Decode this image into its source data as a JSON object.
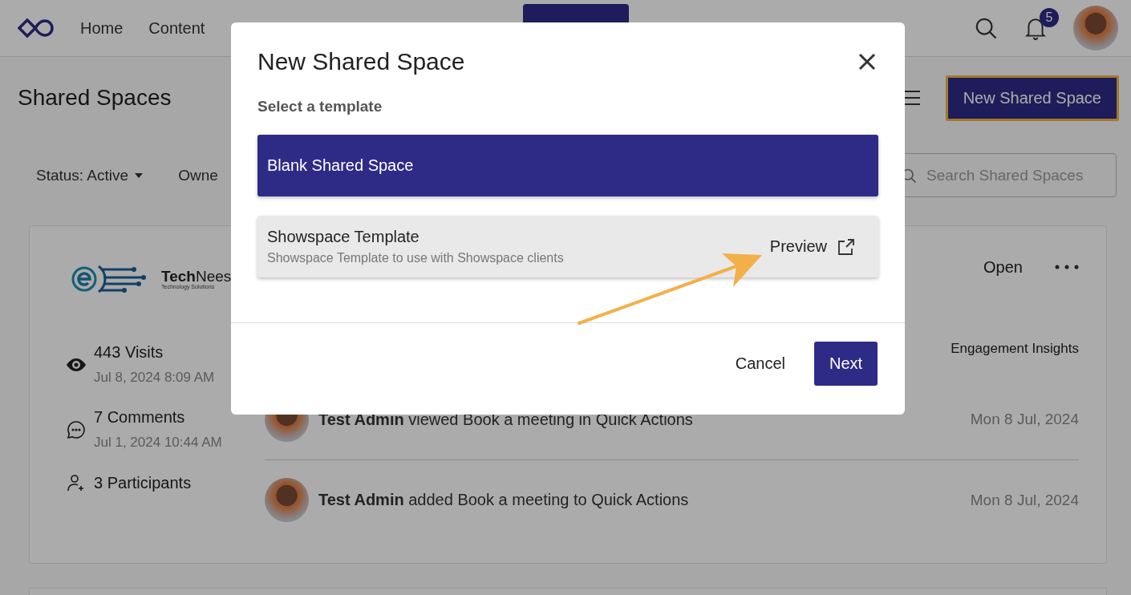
{
  "nav": {
    "items": [
      {
        "label": "Home"
      },
      {
        "label": "Content"
      }
    ],
    "notifications": "5"
  },
  "page": {
    "title": "Shared Spaces",
    "new_button": "New Shared Space"
  },
  "filters": {
    "status": "Status: Active",
    "owner": "Owne",
    "search": {
      "placeholder": "Search Shared Spaces"
    }
  },
  "card": {
    "logo": {
      "name": "**Tech**Nees",
      "tagline": "Technology Solutions"
    },
    "stats": [
      {
        "kind": "visits",
        "label": "443 Visits",
        "date": "Jul 8, 2024 8:09 AM"
      },
      {
        "kind": "comments",
        "label": "7 Comments",
        "date": "Jul 1, 2024 10:44 AM"
      },
      {
        "kind": "participants",
        "label": "3 Participants"
      }
    ],
    "open": "Open",
    "insights": "Engagement Insights",
    "activity": [
      {
        "text": "**Test Admin** viewed Book a meeting in Quick Actions",
        "date": "Mon 8 Jul, 2024"
      },
      {
        "text": "**Test Admin** added Book a meeting to Quick Actions",
        "date": "Mon 8 Jul, 2024"
      }
    ]
  },
  "modal": {
    "title": "New Shared Space",
    "subtitle": "Select a template",
    "templates": [
      {
        "title": "Blank Shared Space",
        "selected": true
      },
      {
        "title": "Showspace Template",
        "description": "Showspace Template to use with Showspace clients",
        "preview": "Preview",
        "selected": false
      }
    ],
    "cancel": "Cancel",
    "next": "Next"
  }
}
